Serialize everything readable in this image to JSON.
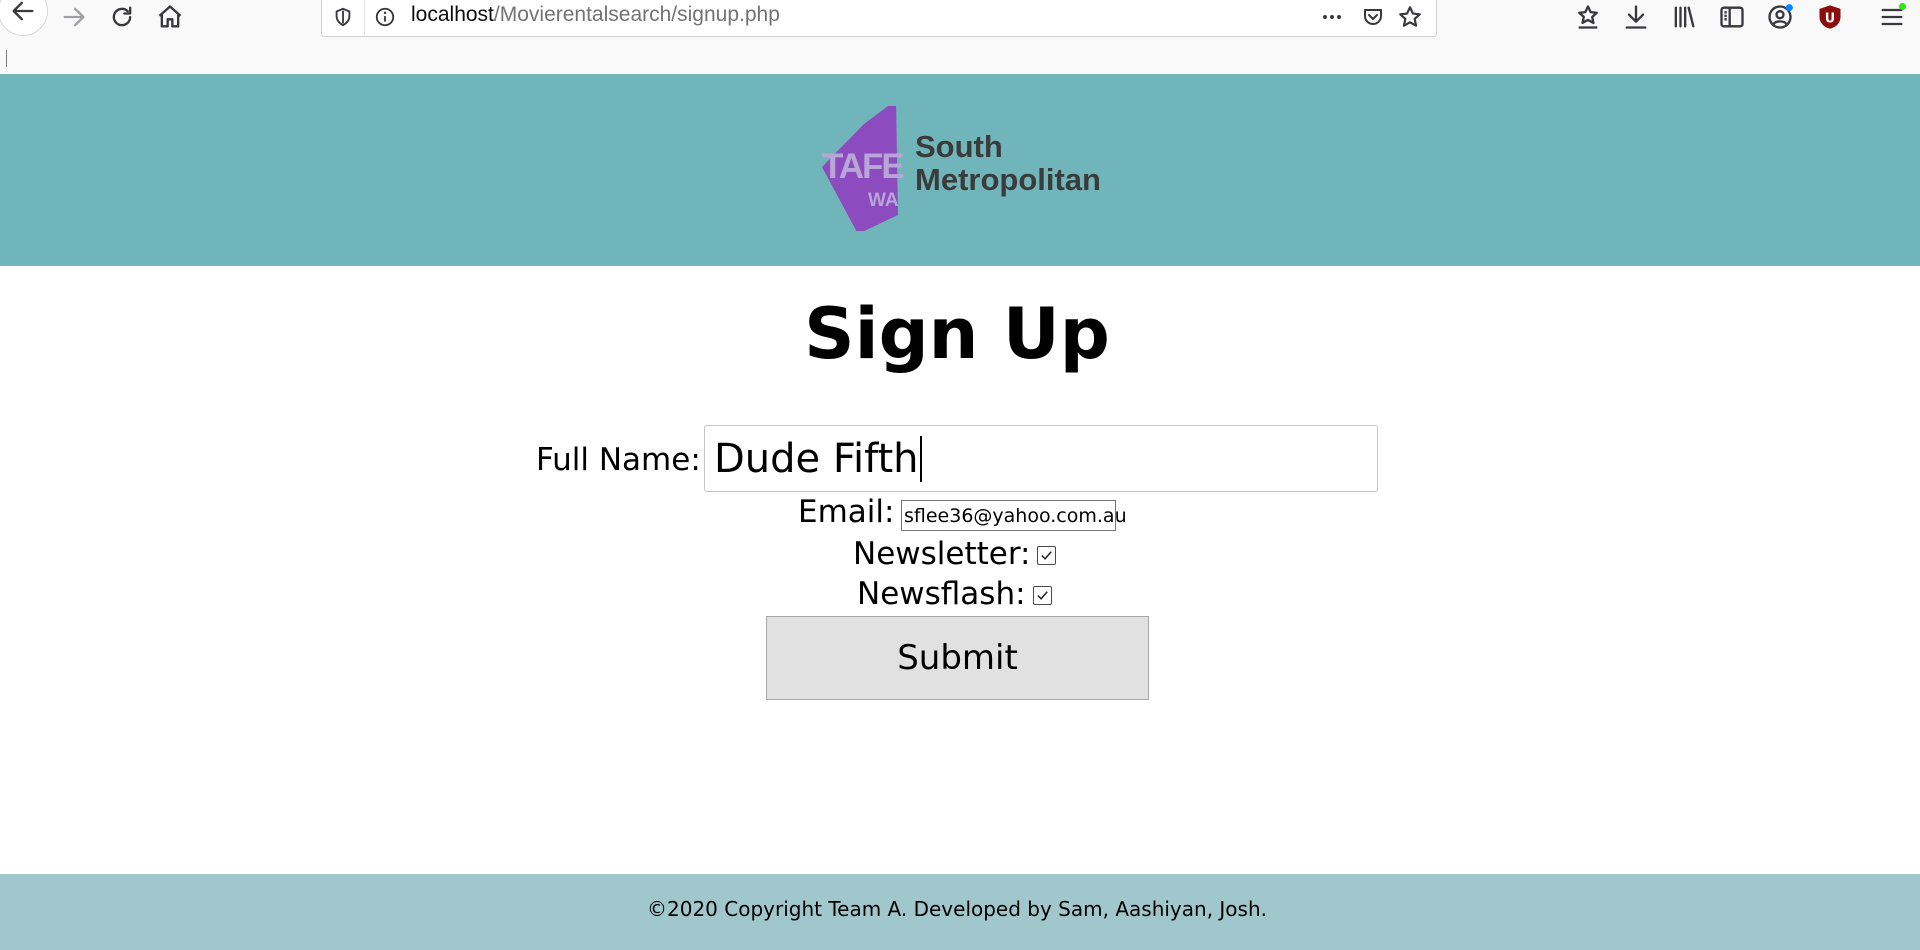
{
  "browser": {
    "url_host": "localhost",
    "url_path": "/Movierentalsearch/signup.php",
    "profile_badge": "U"
  },
  "header": {
    "logo_mark_top": "TAFE",
    "logo_mark_bottom": "WA",
    "logo_text": "South\nMetropolitan"
  },
  "page": {
    "title": "Sign Up"
  },
  "form": {
    "full_name_label": "Full Name:",
    "full_name_value": "Dude Fifth",
    "email_label": "Email:",
    "email_value": "sflee36@yahoo.com.au",
    "newsletter_label": "Newsletter:",
    "newsletter_checked": true,
    "newsflash_label": "Newsflash:",
    "newsflash_checked": true,
    "submit_label": "Submit"
  },
  "footer": {
    "text": "©2020 Copyright Team A. Developed by Sam, Aashiyan, Josh."
  },
  "colors": {
    "header_bg": "#6fb5b9",
    "footer_bg": "#a0c7cb",
    "logo_purple": "#8c4cc0",
    "badge_red": "#8b0d0d"
  }
}
